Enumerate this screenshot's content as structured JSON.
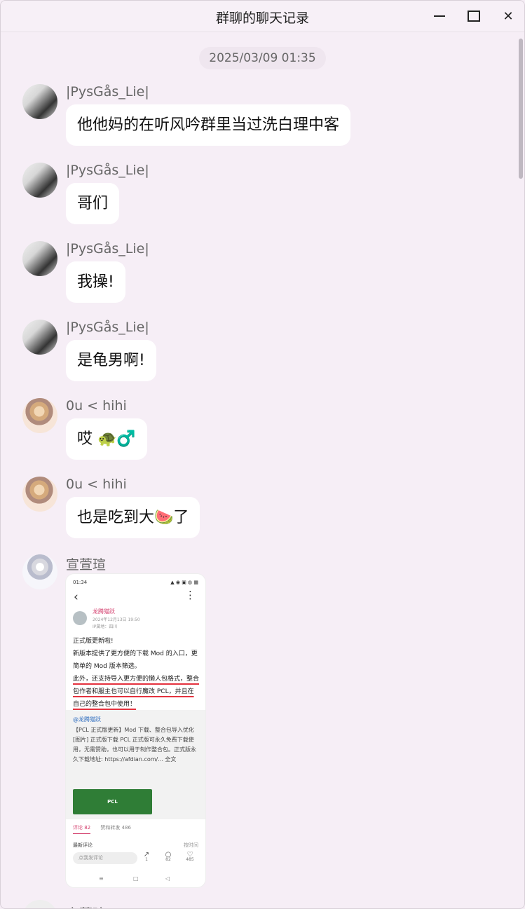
{
  "window": {
    "title": "群聊的聊天记录"
  },
  "timestamp": "2025/03/09 01:35",
  "messages": [
    {
      "name": "|PysGås_Lie|",
      "text": "他他妈的在听风吟群里当过洗白理中客"
    },
    {
      "name": "|PysGås_Lie|",
      "text": "哥们"
    },
    {
      "name": "|PysGås_Lie|",
      "text": "我操!"
    },
    {
      "name": "|PysGås_Lie|",
      "text": "是龟男啊!"
    },
    {
      "name": "0u < hihi",
      "text": "哎 🐢♂️"
    },
    {
      "name": "0u < hihi",
      "text": "也是吃到大🍉了"
    },
    {
      "name": "宣萱瑄"
    }
  ],
  "screenshot_card": {
    "status_time": "01:34",
    "status_icons": "▲ ◉ ▣ ◍ ▦",
    "author": "龙腾猫跃",
    "date": "2024年12月13日 19:50",
    "location": "IP属地：四川",
    "lines": [
      "正式版更新啦!",
      "新版本提供了更方便的下载 Mod 的入口，更简单的 Mod 版本筛选。",
      "此外，还支持导入更方便的懒人包格式，整合包作者和服主也可以自行魔改 PCL，并且在自己的整合包中使用！"
    ],
    "quote_author": "@龙腾猫跃",
    "quote_text": "【PCL 正式版更新】Mod 下载、整合包导入优化 [图片] 正式版下载 PCL 正式版可永久免费下载使用，无需赞助，也可以用于制作整合包。正式版永久下载地址: https://afdian.com/... 全文",
    "banner_text": "PCL",
    "tab_comments": "评论 82",
    "tab_reposts": "赞和转发 486",
    "latest_comments": "最新评论",
    "sort": "按时间",
    "comment_placeholder": "点我发评论",
    "actions": [
      {
        "icon": "↗",
        "count": "1"
      },
      {
        "icon": "○",
        "count": "82"
      },
      {
        "icon": "♡",
        "count": "485"
      }
    ],
    "nav": [
      "≡",
      "□",
      "◁"
    ]
  },
  "partial_next_name": "宣萱瑄"
}
